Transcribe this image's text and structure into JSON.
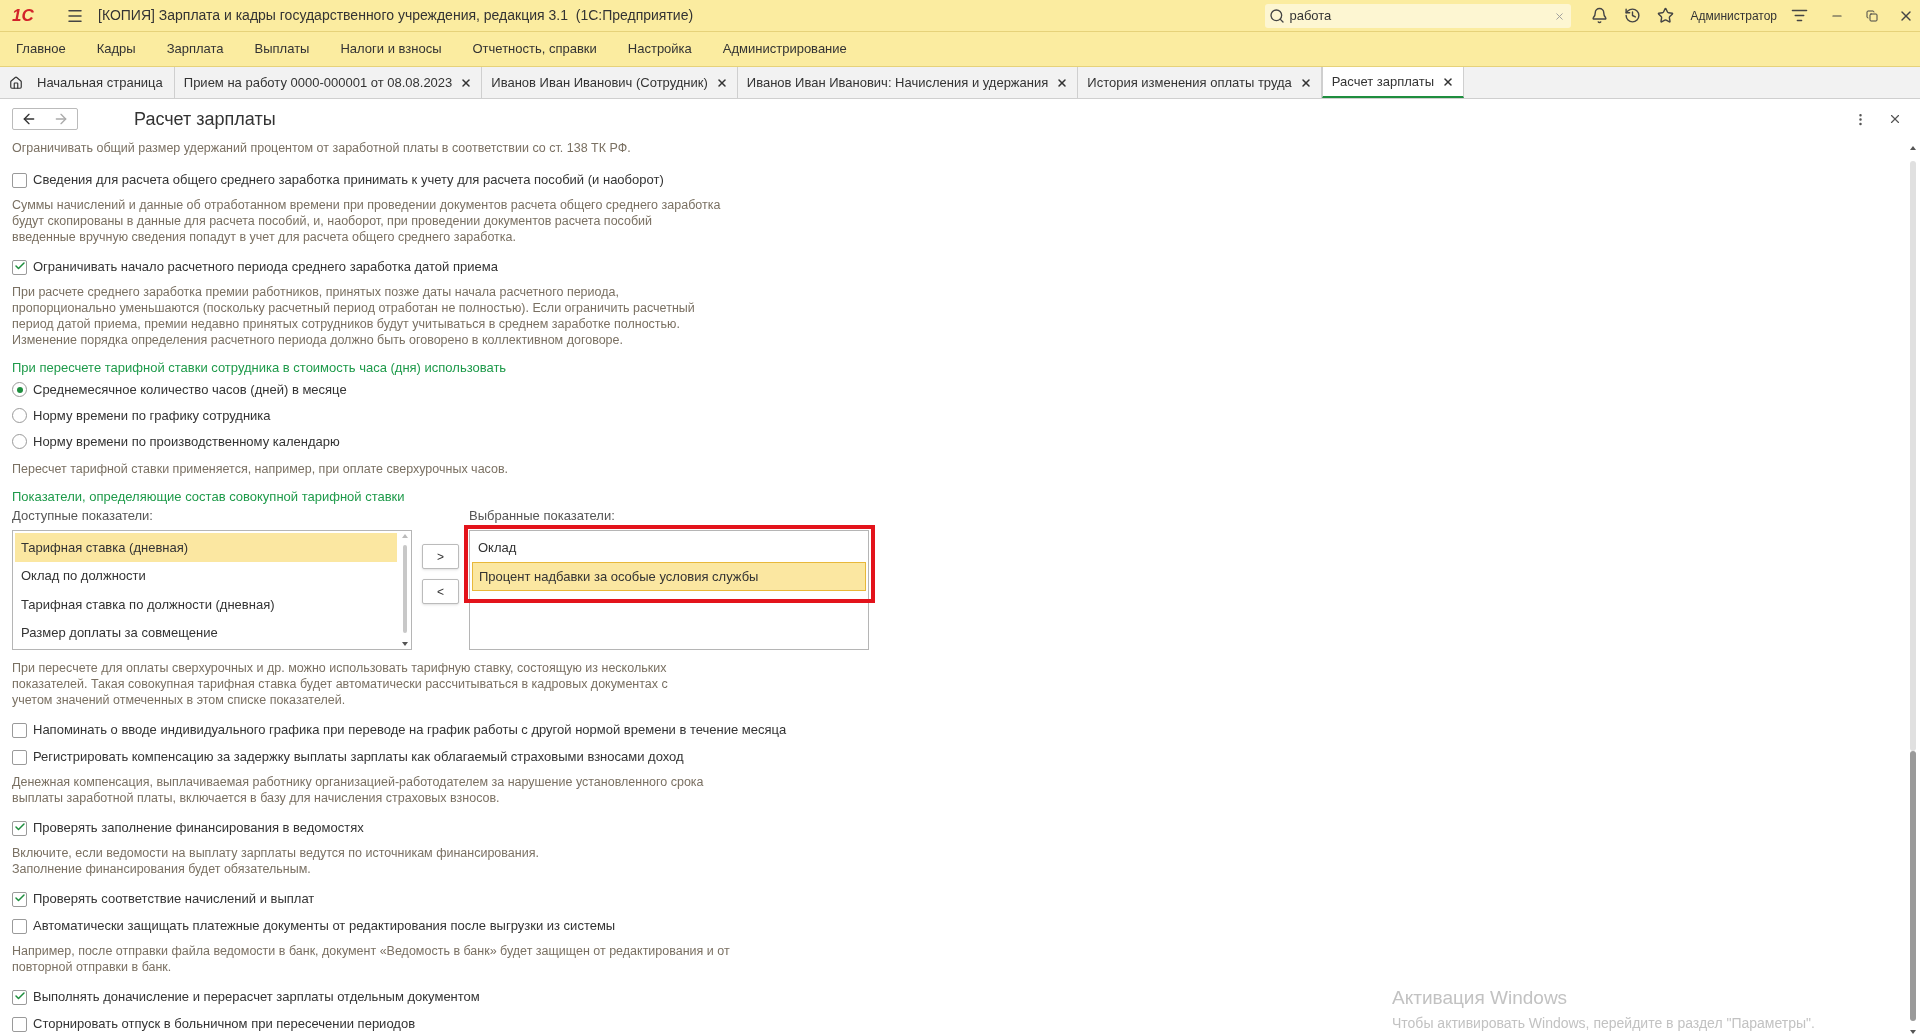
{
  "window": {
    "logo": "1С",
    "title": "[КОПИЯ] Зарплата и кадры государственного учреждения, редакция 3.1  (1С:Предприятие)"
  },
  "search": {
    "value": "работа"
  },
  "user": "Администратор",
  "menu": [
    "Главное",
    "Кадры",
    "Зарплата",
    "Выплаты",
    "Налоги и взносы",
    "Отчетность, справки",
    "Настройка",
    "Администрирование"
  ],
  "tabs": [
    {
      "kind": "home",
      "label": "Начальная страница",
      "selected": false
    },
    {
      "kind": "doc",
      "label": "Прием на работу 0000-000001 от 08.08.2023",
      "selected": false
    },
    {
      "kind": "doc",
      "label": "Иванов Иван Иванович (Сотрудник)",
      "selected": false
    },
    {
      "kind": "doc",
      "label": "Иванов Иван Иванович: Начисления и удержания",
      "selected": false
    },
    {
      "kind": "doc",
      "label": "История изменения оплаты труда",
      "selected": false
    },
    {
      "kind": "doc",
      "label": "Расчет зарплаты",
      "selected": true
    }
  ],
  "form": {
    "title": "Расчет зарплаты",
    "items": [
      {
        "kind": "text",
        "text": "Ограничивать общий размер удержаний процентом от заработной платы в соответствии со ст. 138 ТК РФ."
      },
      {
        "kind": "checkbox",
        "label": "Сведения для расчета общего среднего заработка принимать к учету для расчета пособий (и наоборот)",
        "checked": false
      },
      {
        "kind": "text",
        "text": "Суммы начислений и данные об отработанном времени при проведении документов расчета общего среднего заработка\nбудут скопированы в данные для расчета пособий, и, наоборот, при проведении документов расчета пособий\nвведенные вручную сведения попадут в учет для расчета общего среднего заработка."
      },
      {
        "kind": "checkbox",
        "label": "Ограничивать начало расчетного периода среднего заработка датой приема",
        "checked": true
      },
      {
        "kind": "text",
        "text": "При расчете среднего заработка премии работников, принятых позже даты начала расчетного периода,\nпропорционально уменьшаются (поскольку расчетный период отработан не полностью). Если ограничить расчетный\nпериод датой приема, премии недавно принятых сотрудников будут учитываться в среднем заработке полностью.\nИзменение порядка определения расчетного периода должно быть оговорено в коллективном договоре."
      },
      {
        "kind": "header",
        "text": "При пересчете тарифной ставки сотрудника в стоимость часа (дня) использовать"
      },
      {
        "kind": "radio",
        "label": "Среднемесячное количество часов (дней) в месяце",
        "selected": true
      },
      {
        "kind": "radio",
        "label": "Норму времени по графику сотрудника",
        "selected": false
      },
      {
        "kind": "radio",
        "label": "Норму времени по производственному календарю",
        "selected": false
      },
      {
        "kind": "text",
        "text": "Пересчет тарифной ставки применяется, например, при оплате сверхурочных часов."
      },
      {
        "kind": "header",
        "text": "Показатели, определяющие состав совокупной тарифной ставки"
      },
      {
        "kind": "lists",
        "available": {
          "label": "Доступные показатели:",
          "items": [
            {
              "label": "Тарифная ставка (дневная)",
              "selected": true
            },
            {
              "label": "Оклад по должности",
              "selected": false
            },
            {
              "label": "Тарифная ставка по должности (дневная)",
              "selected": false
            },
            {
              "label": "Размер доплаты за совмещение",
              "selected": false
            }
          ]
        },
        "buttons": [
          ">",
          "<"
        ],
        "chosen": {
          "label": "Выбранные показатели:",
          "highlighted": true,
          "items": [
            {
              "label": "Оклад",
              "selected": false
            },
            {
              "label": "Процент надбавки за особые условия службы",
              "selected": true
            }
          ]
        }
      },
      {
        "kind": "text",
        "text": "При пересчете для оплаты сверхурочных и др. можно использовать тарифную ставку, состоящую из нескольких\nпоказателей. Такая совокупная тарифная ставка будет автоматически рассчитываться в кадровых документах с\nучетом значений отмеченных в этом списке показателей."
      },
      {
        "kind": "checkbox",
        "label": "Напоминать о вводе индивидуального графика при переводе на график работы с другой нормой времени в течение месяца",
        "checked": false
      },
      {
        "kind": "checkbox",
        "label": "Регистрировать компенсацию за задержку выплаты зарплаты как облагаемый страховыми взносами доход",
        "checked": false
      },
      {
        "kind": "text",
        "text": "Денежная компенсация, выплачиваемая работнику организацией-работодателем за нарушение установленного срока\nвыплаты заработной платы, включается в базу для начисления страховых взносов."
      },
      {
        "kind": "checkbox",
        "label": "Проверять заполнение финансирования в ведомостях",
        "checked": true
      },
      {
        "kind": "text",
        "text": "Включите, если ведомости на выплату зарплаты ведутся по источникам финансирования.\nЗаполнение финансирования будет обязательным."
      },
      {
        "kind": "checkbox",
        "label": "Проверять соответствие начислений и выплат",
        "checked": true
      },
      {
        "kind": "checkbox",
        "label": "Автоматически защищать платежные документы от редактирования после выгрузки из системы",
        "checked": false
      },
      {
        "kind": "text",
        "text": "Например, после отправки файла ведомости в банк, документ «Ведомость в банк» будет защищен от редактирования и от\nповторной отправки в банк."
      },
      {
        "kind": "checkbox",
        "label": "Выполнять доначисление и перерасчет зарплаты отдельным документом",
        "checked": true
      },
      {
        "kind": "checkbox",
        "label": "Сторнировать отпуск в больничном при пересечении периодов",
        "checked": false
      }
    ]
  },
  "activation": {
    "title": "Активация Windows",
    "text": "Чтобы активировать Windows, перейдите в раздел \"Параметры\"."
  }
}
